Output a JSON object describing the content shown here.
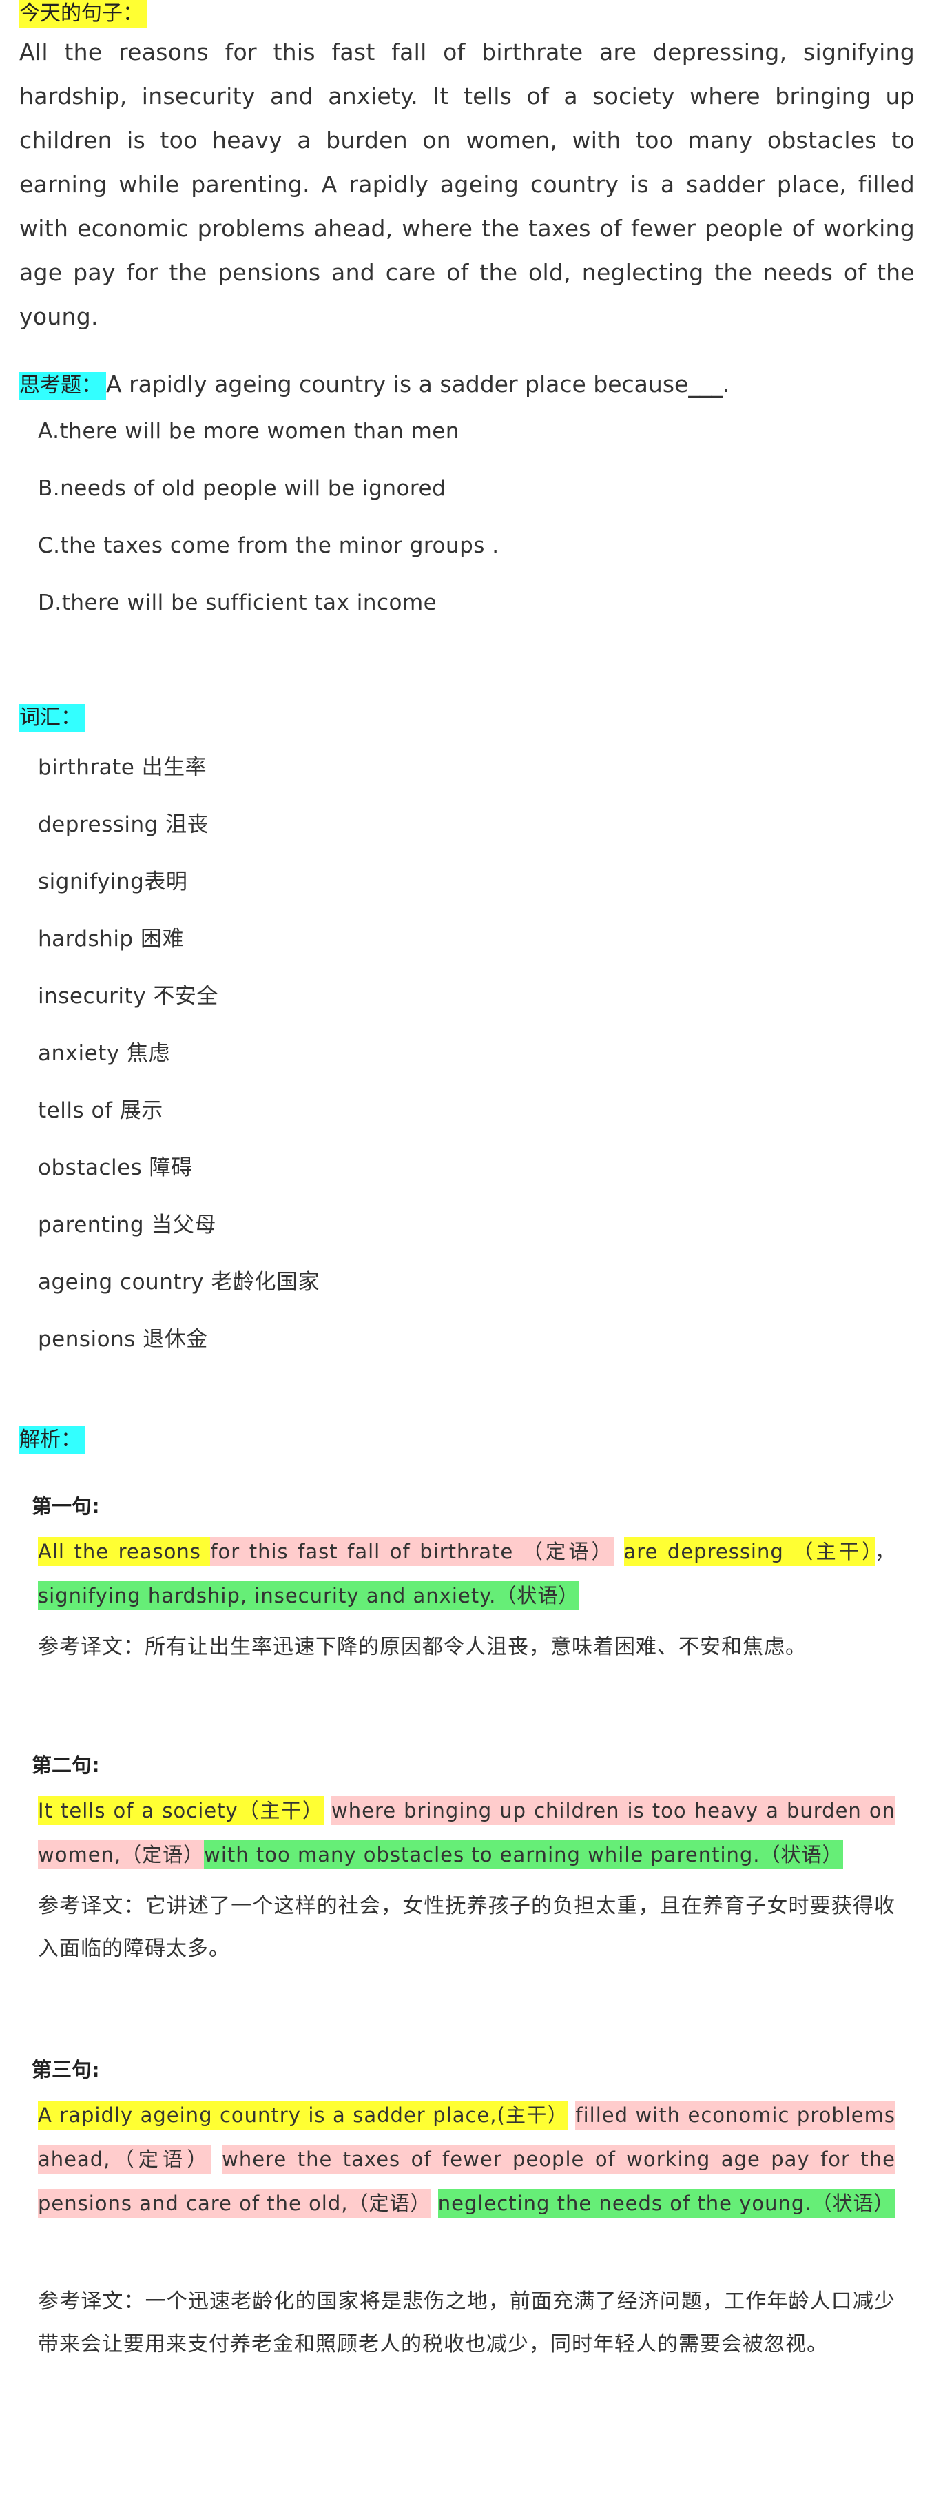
{
  "today_label": "今天的句子：",
  "today_sentence": "All the reasons for this fast fall of birthrate are depressing, signifying hardship, insecurity and anxiety. It tells of a society where bringing up children is too heavy a burden on women, with too many obstacles to earning while parenting. A rapidly ageing country is a sadder place, filled with economic problems ahead, where the taxes of fewer people of working age pay for the pensions and care of the old, neglecting the needs of the young.",
  "question": {
    "label": "思考题：",
    "stem": "A rapidly ageing country is a sadder place because___.",
    "options": [
      "A.there will be more women than men",
      "B.needs of old people will be ignored",
      "C.the taxes come from the minor groups .",
      "D.there will be sufficient tax income"
    ]
  },
  "vocab": {
    "label": "词汇：",
    "items": [
      "birthrate 出生率",
      "depressing 沮丧",
      "signifying表明",
      "hardship 困难",
      "insecurity 不安全",
      "anxiety 焦虑",
      "tells of 展示",
      "obstacles 障碍",
      "parenting 当父母",
      "ageing country 老龄化国家",
      "pensions 退休金"
    ]
  },
  "analysis": {
    "label": "解析：",
    "s1": {
      "title": "第一句:",
      "p1": "All the reasons ",
      "p2": "for this fast fall of birthrate （定语）",
      "p3": "are depressing （主干）",
      "p4": "，",
      "p5": "signifying hardship, insecurity and anxiety.（状语）",
      "ref": "参考译文：所有让出生率迅速下降的原因都令人沮丧，意味着困难、不安和焦虑。"
    },
    "s2": {
      "title": "第二句:",
      "p1": "It tells of a society（主干）",
      "p2": "where bringing up children is too heavy a burden on women,（定语）",
      "p3": "with too many obstacles to earning while parenting.（状语）",
      "ref": "参考译文：它讲述了一个这样的社会，女性抚养孩子的负担太重，且在养育子女时要获得收入面临的障碍太多。"
    },
    "s3": {
      "title": "第三句:",
      "p1": "A rapidly ageing country is a sadder place,(主干）",
      "p2": "filled with economic problems ahead,（定语）",
      "p3": "where the taxes of fewer people of working age pay for the pensions and care of the old,（定语）",
      "p4": "neglecting the needs of the young.（状语）",
      "ref": "参考译文：一个迅速老龄化的国家将是悲伤之地，前面充满了经济问题，工作年龄人口减少带来会让要用来支付养老金和照顾老人的税收也减少，同时年轻人的需要会被忽视。"
    }
  }
}
